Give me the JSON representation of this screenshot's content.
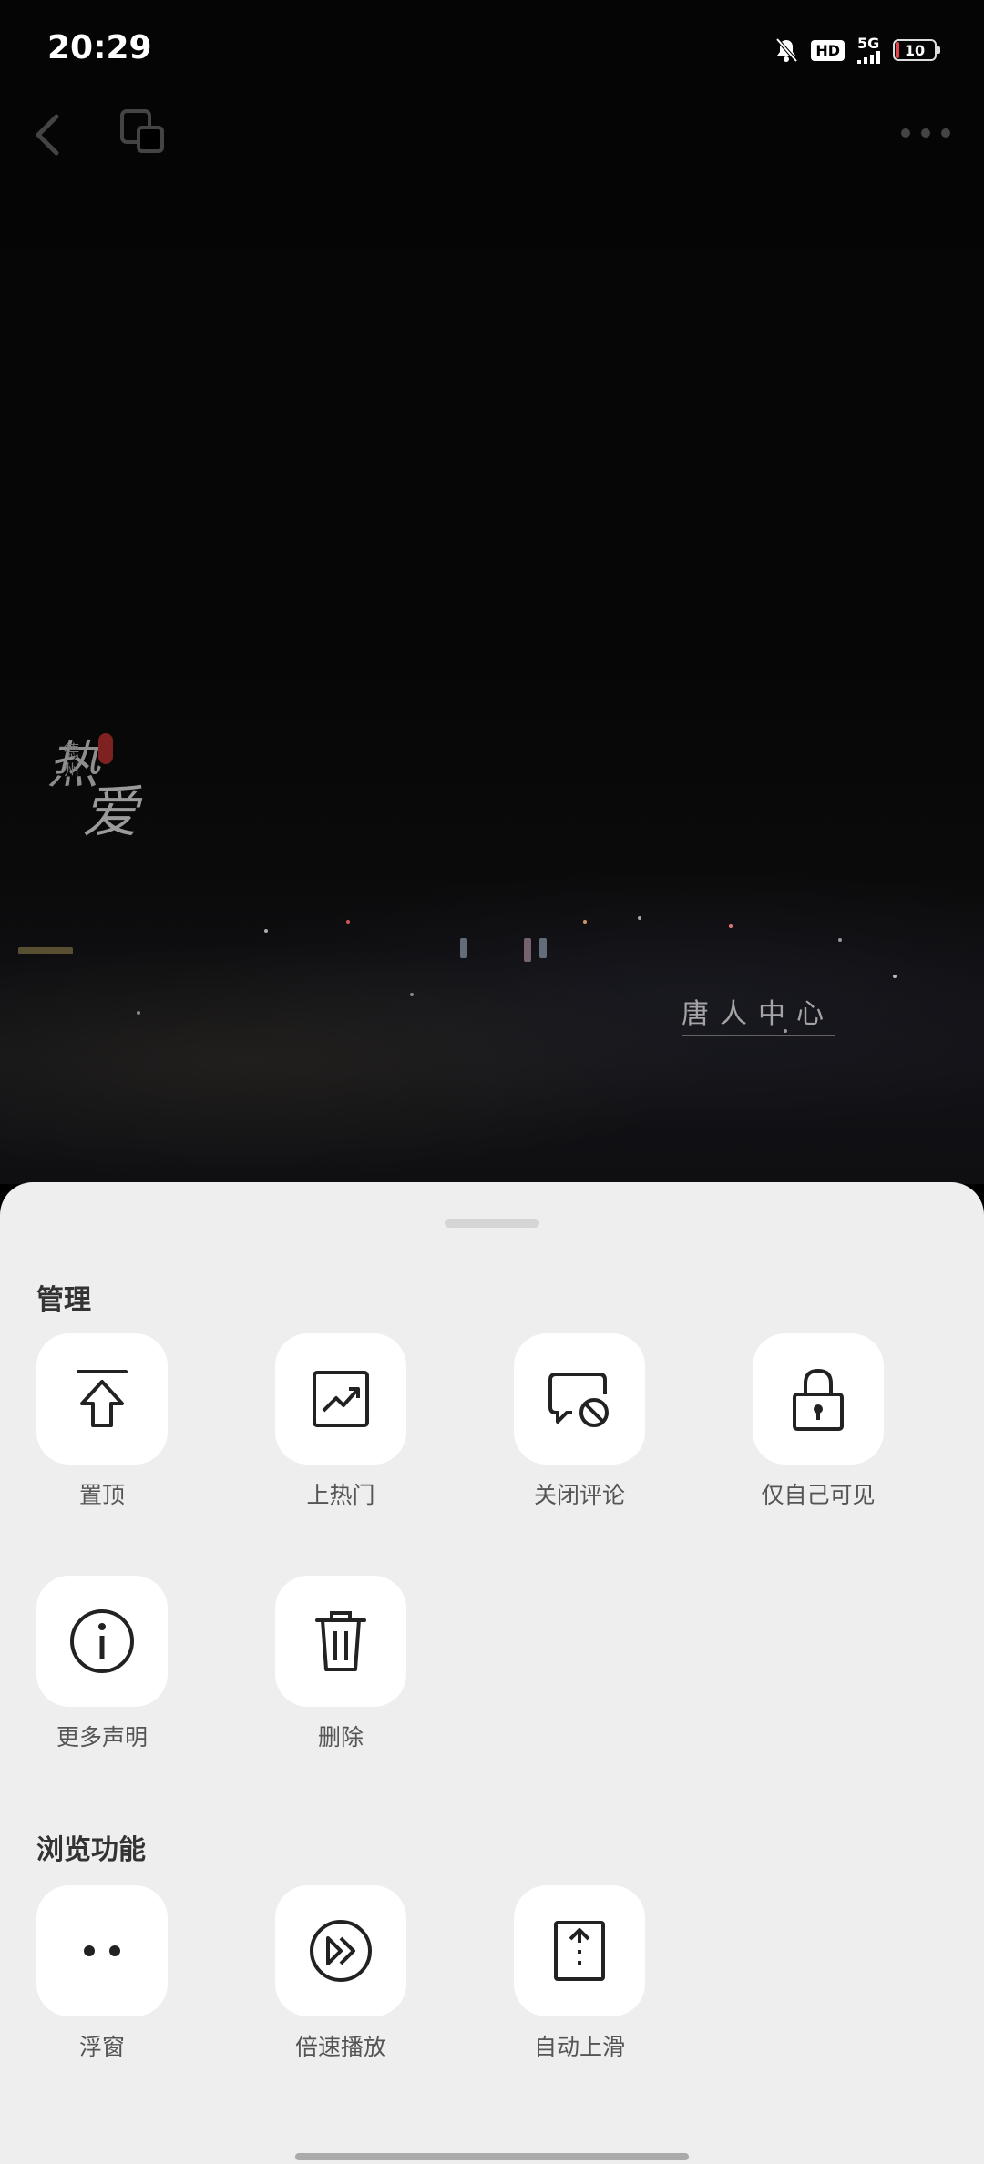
{
  "status_bar": {
    "time": "20:29",
    "hd": "HD",
    "network": "5G",
    "battery": "10"
  },
  "nav": {
    "back_icon": "chevron-left-icon",
    "window_icon": "picture-in-picture-icon",
    "more_icon": "more-horizontal-icon"
  },
  "video": {
    "watermark_big1": "热",
    "watermark_big2": "爱",
    "watermark_small": "德州",
    "caption": "唐人中心"
  },
  "sheet": {
    "manage_title": "管理",
    "browse_title": "浏览功能",
    "manage_items": [
      {
        "label": "置顶",
        "icon": "pin-top-icon"
      },
      {
        "label": "上热门",
        "icon": "trending-icon"
      },
      {
        "label": "关闭评论",
        "icon": "comment-off-icon"
      },
      {
        "label": "仅自己可见",
        "icon": "lock-icon"
      },
      {
        "label": "更多声明",
        "icon": "info-icon"
      },
      {
        "label": "删除",
        "icon": "trash-icon"
      }
    ],
    "browse_items": [
      {
        "label": "浮窗",
        "icon": "floating-window-icon"
      },
      {
        "label": "倍速播放",
        "icon": "speed-play-icon"
      },
      {
        "label": "自动上滑",
        "icon": "auto-scroll-icon"
      }
    ]
  },
  "colors": {
    "sheet_bg": "#eeeeee",
    "tile_bg": "#ffffff",
    "icon_stroke": "#222222",
    "battery_low": "#e0444a"
  }
}
